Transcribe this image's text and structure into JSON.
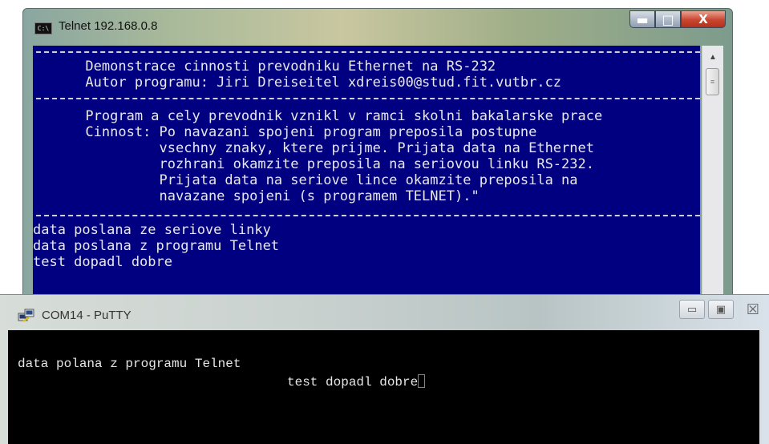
{
  "telnet": {
    "title": "Telnet 192.168.0.8",
    "icon_text": "C:\\",
    "controls": {
      "minimize": "▬",
      "maximize": "□",
      "close": "X"
    },
    "console": {
      "line1": "Demonstrace cinnosti prevodniku Ethernet na RS-232",
      "line2": "Autor programu: Jiri Dreiseitel xdreis00@stud.fit.vutbr.cz",
      "line3": "Program a cely prevodnik vznikl v ramci skolni bakalarske prace",
      "line4": "Cinnost: Po navazani spojeni program preposila postupne",
      "line5": "vsechny znaky, ktere prijme. Prijata data na Ethernet",
      "line6": "rozhrani okamzite preposila na seriovou linku RS-232.",
      "line7": "Prijata data na seriove lince okamzite preposila na",
      "line8": "navazane spojeni (s programem TELNET).\"",
      "line9": "data poslana ze seriove linky",
      "line10": "data poslana z programu Telnet",
      "line11": "test dopadl dobre"
    },
    "colors": {
      "console_bg": "#000080",
      "console_fg": "#e8e8e8"
    }
  },
  "putty": {
    "title": "COM14 - PuTTY",
    "controls": {
      "minimize": "▭",
      "maximize": "▣",
      "close": "☒"
    },
    "console": {
      "line1": "data polana z programu Telnet",
      "line2": "test dopadl dobre"
    },
    "colors": {
      "console_bg": "#000000",
      "cursor": "#00e000"
    }
  }
}
